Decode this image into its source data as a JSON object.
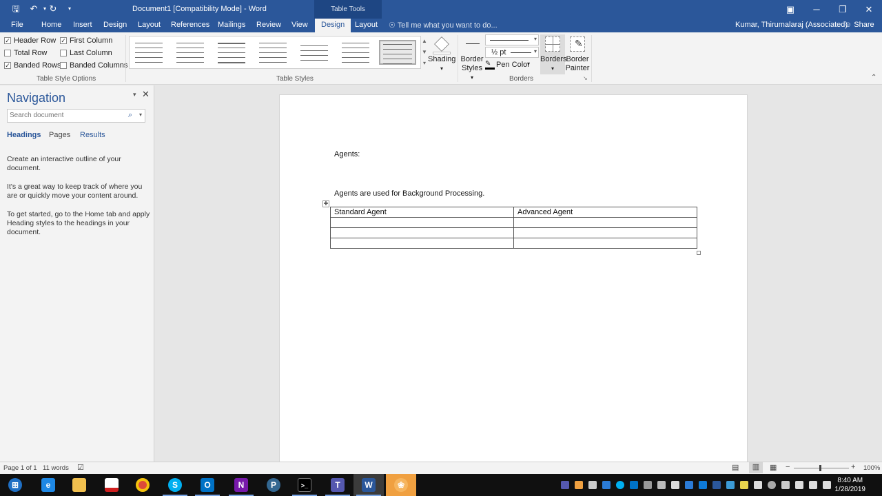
{
  "title_bar": {
    "document_title": "Document1 [Compatibility Mode] - Word",
    "context_tab_group": "Table Tools",
    "colors": {
      "titlebar": "#2b579a",
      "context": "#1e4683"
    }
  },
  "tabs": [
    "File",
    "Home",
    "Insert",
    "Design",
    "Layout",
    "References",
    "Mailings",
    "Review",
    "View",
    "Design",
    "Layout"
  ],
  "tell_me": "Tell me what you want to do...",
  "user": "Kumar, Thirumalaraj (Associated)",
  "share": "Share",
  "ribbon": {
    "table_style_options": {
      "checkboxes": [
        {
          "label": "Header Row",
          "checked": true
        },
        {
          "label": "Total Row",
          "checked": false
        },
        {
          "label": "Banded Rows",
          "checked": true
        },
        {
          "label": "First Column",
          "checked": true
        },
        {
          "label": "Last Column",
          "checked": false
        },
        {
          "label": "Banded Columns",
          "checked": false
        }
      ],
      "group_label": "Table Style Options"
    },
    "table_styles": {
      "group_label": "Table Styles"
    },
    "shading": "Shading",
    "border_styles": [
      "Border",
      "Styles"
    ],
    "line_weight": "½ pt",
    "pen_color": "Pen Color",
    "borders": "Borders",
    "border_painter": [
      "Border",
      "Painter"
    ],
    "borders_group_label": "Borders"
  },
  "nav": {
    "title": "Navigation",
    "search_placeholder": "Search document",
    "tabs": [
      "Headings",
      "Pages",
      "Results"
    ],
    "text": [
      "Create an interactive outline of your document.",
      "It's a great way to keep track of where you are or quickly move your content around.",
      "To get started, go to the Home tab and apply Heading styles to the headings in your document."
    ]
  },
  "document": {
    "heading": "Agents:",
    "paragraph": "Agents are used for Background Processing.",
    "table": [
      [
        "Standard Agent",
        "Advanced Agent"
      ],
      [
        "",
        ""
      ],
      [
        "",
        ""
      ],
      [
        "",
        ""
      ]
    ]
  },
  "status": {
    "page": "Page 1 of 1",
    "words": "11 words",
    "zoom": "100%"
  },
  "taskbar": {
    "time": "8:40 AM",
    "date": "1/28/2019"
  }
}
